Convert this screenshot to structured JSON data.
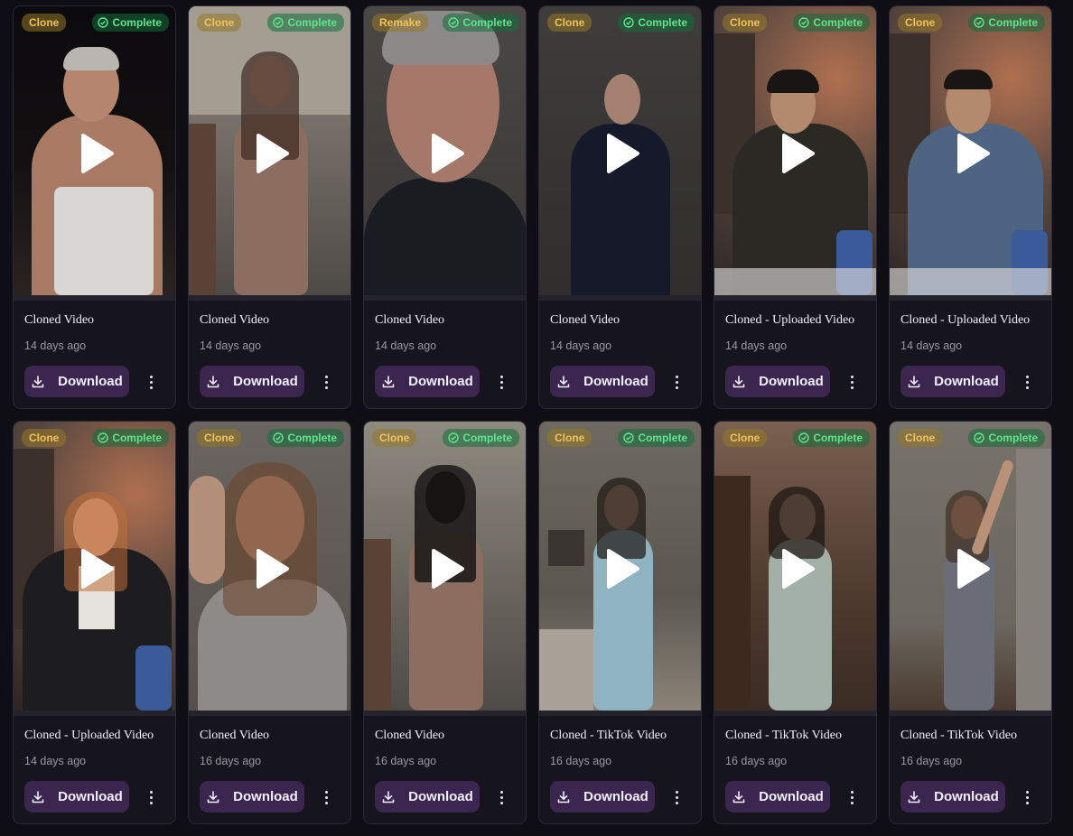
{
  "colors": {
    "background": "#0f0e14",
    "card": "#16151d",
    "download_button": "#3b2650",
    "type_badge_text": "#f0c25a",
    "status_badge_text": "#5de68e"
  },
  "icons": {
    "play": "play-icon",
    "status": "check-circle-icon",
    "download": "download-icon",
    "more": "more-vertical-icon"
  },
  "cards": [
    {
      "type": "Clone",
      "status": "Complete",
      "title": "Cloned Video",
      "time": "14 days ago",
      "download": "Download"
    },
    {
      "type": "Clone",
      "status": "Complete",
      "title": "Cloned Video",
      "time": "14 days ago",
      "download": "Download"
    },
    {
      "type": "Remake",
      "status": "Complete",
      "title": "Cloned Video",
      "time": "14 days ago",
      "download": "Download"
    },
    {
      "type": "Clone",
      "status": "Complete",
      "title": "Cloned Video",
      "time": "14 days ago",
      "download": "Download"
    },
    {
      "type": "Clone",
      "status": "Complete",
      "title": "Cloned - Uploaded Video",
      "time": "14 days ago",
      "download": "Download"
    },
    {
      "type": "Clone",
      "status": "Complete",
      "title": "Cloned - Uploaded Video",
      "time": "14 days ago",
      "download": "Download"
    },
    {
      "type": "Clone",
      "status": "Complete",
      "title": "Cloned - Uploaded Video",
      "time": "14 days ago",
      "download": "Download"
    },
    {
      "type": "Clone",
      "status": "Complete",
      "title": "Cloned Video",
      "time": "16 days ago",
      "download": "Download"
    },
    {
      "type": "Clone",
      "status": "Complete",
      "title": "Cloned Video",
      "time": "16 days ago",
      "download": "Download"
    },
    {
      "type": "Clone",
      "status": "Complete",
      "title": "Cloned - TikTok Video",
      "time": "16 days ago",
      "download": "Download"
    },
    {
      "type": "Clone",
      "status": "Complete",
      "title": "Cloned - TikTok Video",
      "time": "16 days ago",
      "download": "Download"
    },
    {
      "type": "Clone",
      "status": "Complete",
      "title": "Cloned - TikTok Video",
      "time": "16 days ago",
      "download": "Download"
    }
  ]
}
